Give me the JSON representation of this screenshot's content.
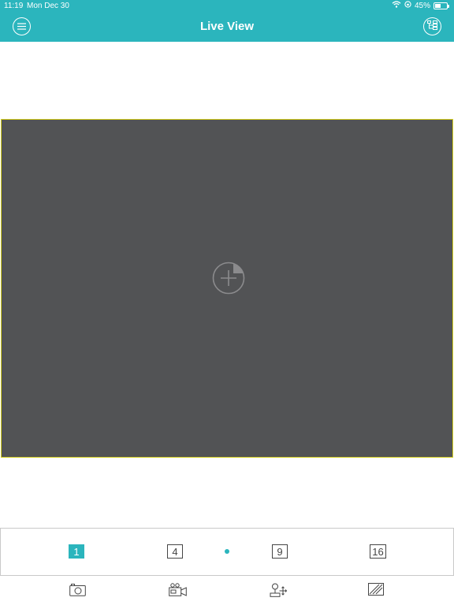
{
  "status_bar": {
    "time": "11:19",
    "date": "Mon Dec 30",
    "battery_percent": "45%",
    "battery_level": 0.45
  },
  "header": {
    "title": "Live View",
    "menu_icon": "menu-icon",
    "device_tree_icon": "device-tree-icon",
    "background_color": "#2bb5bd"
  },
  "viewport": {
    "background_color": "#525355",
    "selected_border_color": "#d4cf1f",
    "add_icon": "add-camera-icon"
  },
  "layout_selector": {
    "options": [
      {
        "label": "1",
        "selected": true
      },
      {
        "label": "4",
        "selected": false
      },
      {
        "label": "9",
        "selected": false
      },
      {
        "label": "16",
        "selected": false
      }
    ],
    "page_indicator_active": true
  },
  "toolbar": {
    "tools": [
      "snapshot-icon",
      "record-icon",
      "ptz-icon",
      "image-settings-icon"
    ]
  }
}
